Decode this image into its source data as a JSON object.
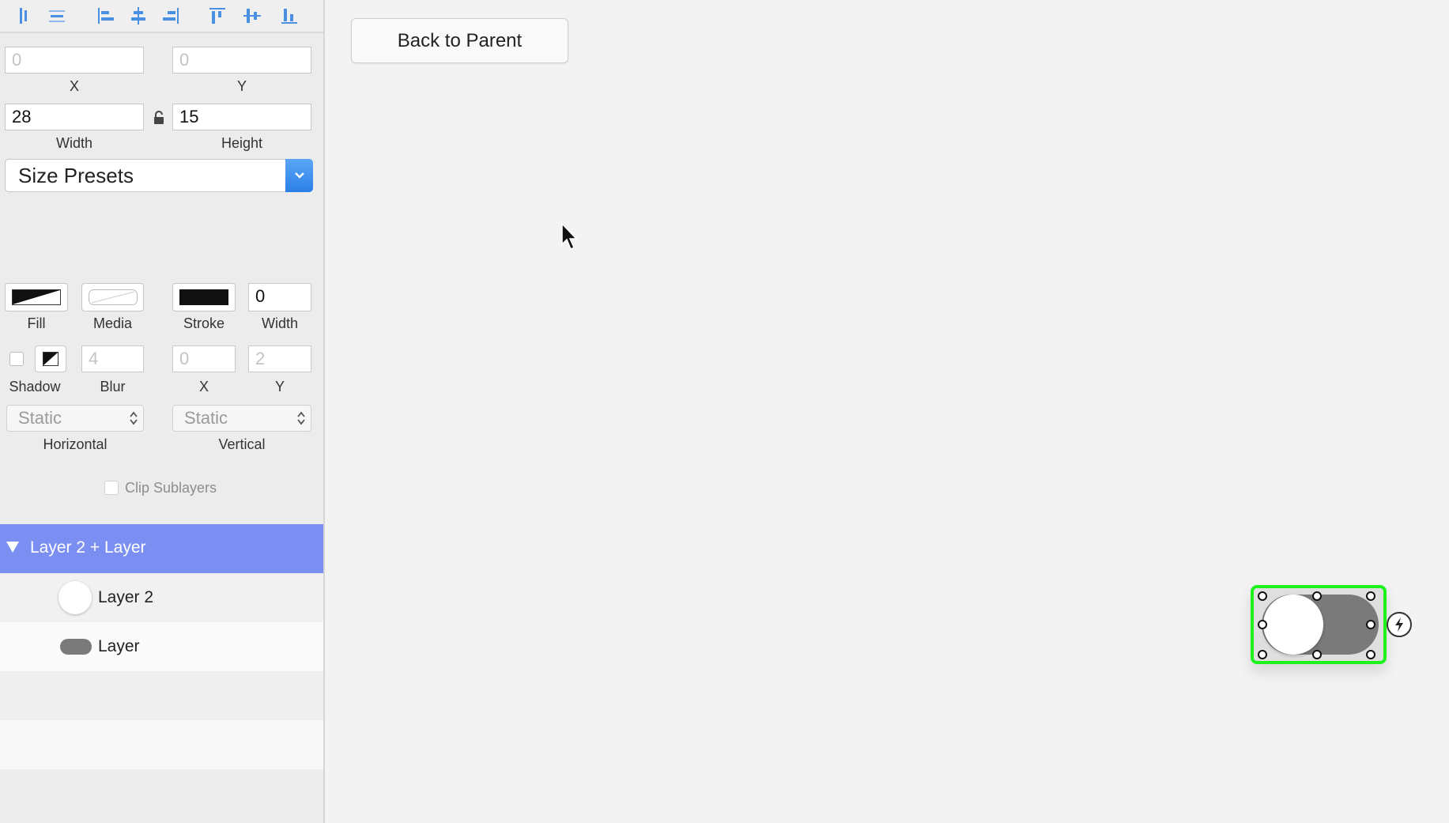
{
  "toolbar": {
    "icons": [
      "align-left-edges-icon",
      "distribute-horizontal-icon",
      "align-left-icon",
      "align-center-icon",
      "align-right-icon",
      "align-top-icon",
      "align-middle-icon",
      "align-bottom-icon"
    ]
  },
  "position": {
    "x_value": "0",
    "x_label": "X",
    "y_value": "0",
    "y_label": "Y"
  },
  "size": {
    "width_value": "28",
    "width_label": "Width",
    "height_value": "15",
    "height_label": "Height"
  },
  "size_presets": {
    "label": "Size Presets"
  },
  "appearance": {
    "fill_label": "Fill",
    "media_label": "Media",
    "stroke_label": "Stroke",
    "stroke_width_value": "0",
    "stroke_width_label": "Width"
  },
  "shadow": {
    "label": "Shadow",
    "blur_value": "4",
    "blur_label": "Blur",
    "x_value": "0",
    "x_label": "X",
    "y_value": "2",
    "y_label": "Y"
  },
  "constraints": {
    "horizontal_value": "Static",
    "horizontal_label": "Horizontal",
    "vertical_value": "Static",
    "vertical_label": "Vertical"
  },
  "clip": {
    "label": "Clip Sublayers"
  },
  "layers": {
    "group_label": "Layer 2 + Layer",
    "items": [
      {
        "label": "Layer 2"
      },
      {
        "label": "Layer"
      }
    ]
  },
  "canvas": {
    "back_button_label": "Back to Parent"
  },
  "colors": {
    "accent": "#7b8ef2",
    "selection": "#1ef21e",
    "dropdown": "#2b7fe8",
    "toggle_track": "#7a7a7a"
  }
}
